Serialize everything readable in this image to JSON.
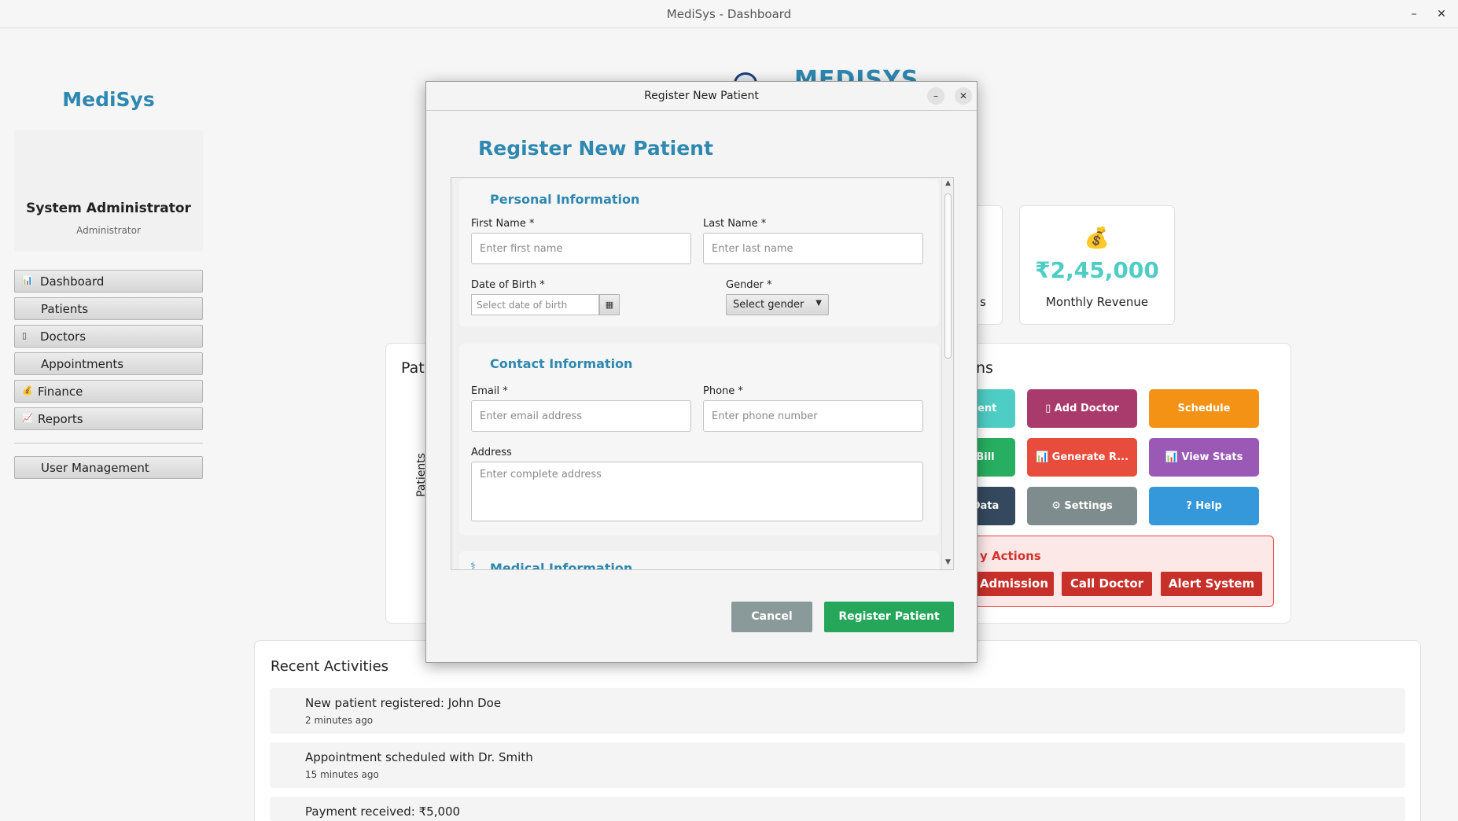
{
  "window": {
    "title": "MediSys - Dashboard",
    "minimize_icon": "–",
    "close_icon": "✕"
  },
  "sidebar": {
    "brand": "MediSys",
    "user": {
      "name": "System Administrator",
      "role": "Administrator"
    },
    "items": [
      {
        "label": "Dashboard",
        "icon": "📊"
      },
      {
        "label": "Patients",
        "icon": ""
      },
      {
        "label": "Doctors",
        "icon": "▯"
      },
      {
        "label": "Appointments",
        "icon": ""
      },
      {
        "label": "Finance",
        "icon": "💰"
      },
      {
        "label": "Reports",
        "icon": "📈"
      },
      {
        "label": "User Management",
        "icon": ""
      }
    ]
  },
  "dashboard": {
    "header_text": "MEDISYS",
    "stat_partial_label": "s",
    "revenue": {
      "icon": "💰",
      "value": "₹2,45,000",
      "label": "Monthly Revenue"
    },
    "chart_panel": {
      "title_partial": "Pati",
      "ylabel": "Patients"
    },
    "quick_actions": {
      "title_partial": "ns",
      "buttons": [
        {
          "label": "ient",
          "color": "#4ecdc4"
        },
        {
          "label": "▯  Add Doctor",
          "color": "#a93a6c"
        },
        {
          "label": "Schedule",
          "color": "#f39214"
        },
        {
          "label": "Bill",
          "color": "#27ae60"
        },
        {
          "label": "📊 Generate R...",
          "color": "#e74c3c"
        },
        {
          "label": "📊 View Stats",
          "color": "#9b59b6"
        },
        {
          "label": "Data",
          "color": "#34495e"
        },
        {
          "label": "⚙ Settings",
          "color": "#7f8c8d"
        },
        {
          "label": "? Help",
          "color": "#3498db"
        }
      ]
    },
    "emergency": {
      "title_partial": "y Actions",
      "buttons": [
        "cy Admission",
        "Call Doctor",
        "Alert System"
      ]
    },
    "recent": {
      "title": "Recent Activities",
      "items": [
        {
          "text": "New patient registered: John Doe",
          "time": "2 minutes ago"
        },
        {
          "text": "Appointment scheduled with Dr. Smith",
          "time": "15 minutes ago"
        },
        {
          "text": "Payment received: ₹5,000",
          "time": ""
        }
      ]
    }
  },
  "dialog": {
    "title": "Register New Patient",
    "heading": "Register New Patient",
    "personal": {
      "title": "Personal Information",
      "first_name_label": "First Name *",
      "first_name_placeholder": "Enter first name",
      "last_name_label": "Last Name *",
      "last_name_placeholder": "Enter last name",
      "dob_label": "Date of Birth *",
      "dob_placeholder": "Select date of birth",
      "gender_label": "Gender *",
      "gender_value": "Select gender"
    },
    "contact": {
      "title": "Contact Information",
      "email_label": "Email *",
      "email_placeholder": "Enter email address",
      "phone_label": "Phone *",
      "phone_placeholder": "Enter phone number",
      "address_label": "Address",
      "address_placeholder": "Enter complete address"
    },
    "medical": {
      "title": "Medical Information"
    },
    "cancel_label": "Cancel",
    "register_label": "Register Patient"
  }
}
